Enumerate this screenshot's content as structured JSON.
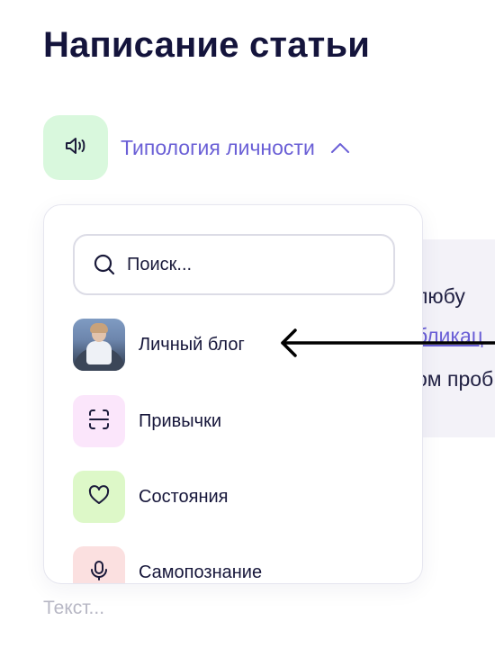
{
  "page": {
    "title": "Написание статьи",
    "text_placeholder": "Текст..."
  },
  "category": {
    "icon": "speaker-icon",
    "label": "Типология личности",
    "chevron": "chevron-up-icon",
    "accent_color": "#6a5fd6",
    "icon_bg": "#d9f8dd"
  },
  "background_content": {
    "lines": [
      "любу",
      "бликац",
      "ом проб"
    ]
  },
  "dropdown": {
    "search": {
      "placeholder": "Поиск...",
      "value": "",
      "icon": "search-icon"
    },
    "items": [
      {
        "label": "Личный блог",
        "icon": "avatar-photo"
      },
      {
        "label": "Привычки",
        "icon": "scan-icon",
        "bg": "#fbe6fb"
      },
      {
        "label": "Состояния",
        "icon": "heart-icon",
        "bg": "#ddf8c8"
      },
      {
        "label": "Самопознание",
        "icon": "microphone-icon",
        "bg": "#fbe0e0"
      }
    ]
  },
  "annotation": {
    "icon": "arrow-left-icon"
  }
}
